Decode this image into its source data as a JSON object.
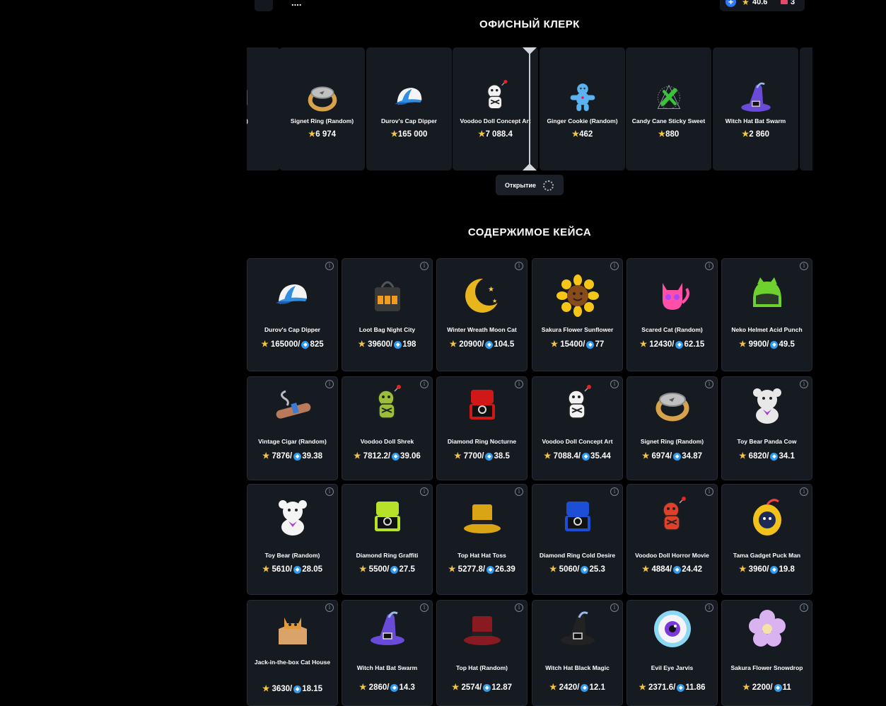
{
  "header": {
    "dots": "....",
    "balance_stars": "40.6",
    "balance_tickets": "3"
  },
  "roulette": {
    "title": "ОФИСНЫЙ КЛЕРК",
    "items": [
      {
        "name": "andom)",
        "price": "",
        "icon": "partial-item-icon",
        "color": "#8a5a2a"
      },
      {
        "name": "Signet Ring (Random)",
        "price": "6 974",
        "icon": "signet-ring-icon",
        "color": "#c0c0c0"
      },
      {
        "name": "Durov's Cap Dipper",
        "price": "165 000",
        "icon": "cap-icon",
        "color": "#2f8de4"
      },
      {
        "name": "Voodoo Doll Concept Art",
        "price": "7 088.4",
        "icon": "voodoo-doll-icon",
        "color": "#f2f2f2"
      },
      {
        "name": "Ginger Cookie (Random)",
        "price": "462",
        "icon": "ginger-cookie-icon",
        "color": "#5ab3f0"
      },
      {
        "name": "Candy Cane Sticky Sweet",
        "price": "880",
        "icon": "candy-cane-icon",
        "color": "#3ac23a"
      },
      {
        "name": "Witch Hat Bat Swarm",
        "price": "2 860",
        "icon": "witch-hat-icon",
        "color": "#6a4bd8"
      },
      {
        "name": "",
        "price": "",
        "icon": "partial-item-icon",
        "color": "#161a21"
      }
    ],
    "open_button": "Открытие"
  },
  "contents": {
    "title": "СОДЕРЖИМОЕ КЕЙСА",
    "items": [
      {
        "name": "Durov's Cap Dipper",
        "stars": "165000/",
        "ton": "825",
        "icon": "cap-icon",
        "color": "#2f8de4"
      },
      {
        "name": "Loot Bag Night City",
        "stars": "39600/",
        "ton": "198",
        "icon": "loot-bag-icon",
        "color": "#3a3a3a"
      },
      {
        "name": "Winter Wreath Moon Cat",
        "stars": "20900/",
        "ton": "104.5",
        "icon": "moon-icon",
        "color": "#e8b51c"
      },
      {
        "name": "Sakura Flower Sunflower",
        "stars": "15400/",
        "ton": "77",
        "icon": "sunflower-icon",
        "color": "#f5c518"
      },
      {
        "name": "Scared Cat (Random)",
        "stars": "12430/",
        "ton": "62.15",
        "icon": "cat-icon",
        "color": "#ff4fa8"
      },
      {
        "name": "Neko Helmet Acid Punch",
        "stars": "9900/",
        "ton": "49.5",
        "icon": "helmet-icon",
        "color": "#6ed12e"
      },
      {
        "name": "Vintage Cigar (Random)",
        "stars": "7876/",
        "ton": "39.38",
        "icon": "cigar-icon",
        "color": "#b87a5a"
      },
      {
        "name": "Voodoo Doll Shrek",
        "stars": "7812.2/",
        "ton": "39.06",
        "icon": "voodoo-doll-icon",
        "color": "#9cbf3a"
      },
      {
        "name": "Diamond Ring Nocturne",
        "stars": "7700/",
        "ton": "38.5",
        "icon": "ring-box-icon",
        "color": "#d01818"
      },
      {
        "name": "Voodoo Doll Concept Art",
        "stars": "7088.4/",
        "ton": "35.44",
        "icon": "voodoo-doll-icon",
        "color": "#f2f2f2"
      },
      {
        "name": "Signet Ring (Random)",
        "stars": "6974/",
        "ton": "34.87",
        "icon": "signet-ring-icon",
        "color": "#c0c0c0"
      },
      {
        "name": "Toy Bear Panda Cow",
        "stars": "6820/",
        "ton": "34.1",
        "icon": "toy-bear-icon",
        "color": "#e8e8e8"
      },
      {
        "name": "Toy Bear (Random)",
        "stars": "5610/",
        "ton": "28.05",
        "icon": "toy-bear-icon",
        "color": "#f4f4f4"
      },
      {
        "name": "Diamond Ring Graffiti",
        "stars": "5500/",
        "ton": "27.5",
        "icon": "ring-box-icon",
        "color": "#b6e22a"
      },
      {
        "name": "Top Hat Hat Toss",
        "stars": "5277.8/",
        "ton": "26.39",
        "icon": "top-hat-icon",
        "color": "#d9a514"
      },
      {
        "name": "Diamond Ring Cold Desire",
        "stars": "5060/",
        "ton": "25.3",
        "icon": "ring-box-icon",
        "color": "#1c4fd6"
      },
      {
        "name": "Voodoo Doll Horror Movie",
        "stars": "4884/",
        "ton": "24.42",
        "icon": "voodoo-doll-icon",
        "color": "#e0402a"
      },
      {
        "name": "Tama Gadget Puck Man",
        "stars": "3960/",
        "ton": "19.8",
        "icon": "tama-gadget-icon",
        "color": "#f2c21a"
      },
      {
        "name": "Jack-in-the-box Cat House",
        "stars": "3630/",
        "ton": "18.15",
        "icon": "cat-box-icon",
        "color": "#e59a3a"
      },
      {
        "name": "Witch Hat Bat Swarm",
        "stars": "2860/",
        "ton": "14.3",
        "icon": "witch-hat-icon",
        "color": "#6a4bd8"
      },
      {
        "name": "Top Hat (Random)",
        "stars": "2574/",
        "ton": "12.87",
        "icon": "top-hat-icon",
        "color": "#8a1a22"
      },
      {
        "name": "Witch Hat Black Magic",
        "stars": "2420/",
        "ton": "12.1",
        "icon": "witch-hat-icon",
        "color": "#222222"
      },
      {
        "name": "Evil Eye Jarvis",
        "stars": "2371.6/",
        "ton": "11.86",
        "icon": "evil-eye-icon",
        "color": "#8ad8f4"
      },
      {
        "name": "Sakura Flower Snowdrop",
        "stars": "2200/",
        "ton": "11",
        "icon": "sakura-flower-icon",
        "color": "#d9b3f0"
      }
    ]
  }
}
